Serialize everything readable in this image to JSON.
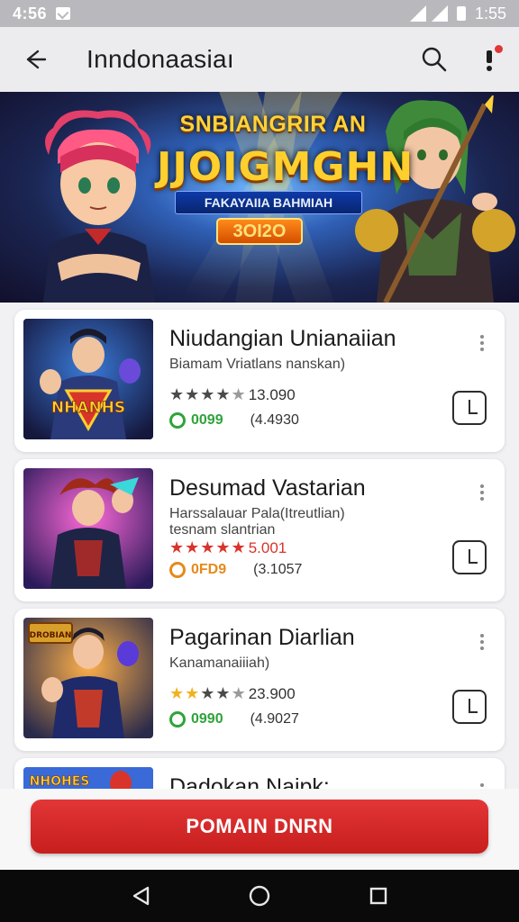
{
  "status_bar": {
    "time": "4:56",
    "right_text": "1:55"
  },
  "app_bar": {
    "title": "Inndonaasiaı"
  },
  "banner": {
    "title_top": "SNBIANGRIR AN",
    "title_main": "JJOIGMGHN",
    "subtitle": "FAKAYAIIA BAHMIAH",
    "badge": "3OI2O",
    "page_count": 5,
    "active_page": 1
  },
  "games": [
    {
      "name": "Niudangian Unianaiian",
      "subtitle": "Biamam Vriatlans nanskan)",
      "subtitle2": "",
      "stars": 4,
      "star_color": "#4a4a4a",
      "rating_text": "13.090",
      "price": "0099",
      "price_color": "#2fa33a",
      "count": "(4.4930",
      "thumb_text": "NHANHS"
    },
    {
      "name": "Desumad Vastarian",
      "subtitle": "Harssalauar Pala(Itreutlian)",
      "subtitle2": "tesnam slantrian",
      "stars": 5,
      "star_color": "#d8342c",
      "rating_text": "5.001",
      "price": "0FD9",
      "price_color": "#e68a1a",
      "count": "(3.1057",
      "thumb_text": ""
    },
    {
      "name": "Pagarinan Diarlian",
      "subtitle": "Kanamanaiiiah)",
      "subtitle2": "",
      "stars": 3,
      "star_color": "#f0b21e",
      "rating_text": "23.900",
      "price": "0990",
      "price_color": "#2fa33a",
      "count": "(4.9027",
      "thumb_text": "DROBIAN"
    },
    {
      "name": "Dadokan Naipk:",
      "subtitle": "",
      "subtitle2": "",
      "stars": 0,
      "star_color": "#4a4a4a",
      "rating_text": "",
      "price": "",
      "price_color": "#2fa33a",
      "count": "",
      "thumb_text": "NHOHES"
    }
  ],
  "cta": {
    "label": "POMAIN DNRN"
  },
  "colors": {
    "accent": "#d92b2b",
    "card_bg": "#ffffff",
    "page_bg": "#f1f1f3"
  }
}
